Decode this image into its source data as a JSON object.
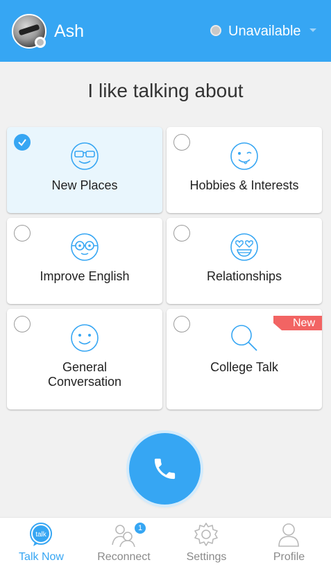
{
  "header": {
    "user_name": "Ash",
    "status_label": "Unavailable",
    "colors": {
      "header_bg": "#36a6f3",
      "status_dot": "#c8c8c8"
    }
  },
  "heading": "I like talking about",
  "topics": [
    {
      "label": "New Places",
      "icon": "sunglasses-face-icon",
      "selected": true
    },
    {
      "label": "Hobbies & Interests",
      "icon": "winking-face-icon",
      "selected": false
    },
    {
      "label": "Improve English",
      "icon": "nerd-glasses-face-icon",
      "selected": false
    },
    {
      "label": "Relationships",
      "icon": "heart-eyes-face-icon",
      "selected": false
    },
    {
      "label": "General Conversation",
      "label_line1": "General",
      "label_line2": "Conversation",
      "icon": "smiling-face-icon",
      "selected": false
    },
    {
      "label": "College Talk",
      "icon": "magnifier-icon",
      "selected": false,
      "badge": "New"
    }
  ],
  "call_button": {
    "icon": "phone-icon"
  },
  "nav": [
    {
      "label": "Talk Now",
      "icon": "talk-bubble-icon",
      "active": true,
      "icon_text": "talk"
    },
    {
      "label": "Reconnect",
      "icon": "people-icon",
      "active": false,
      "badge_count": "1"
    },
    {
      "label": "Settings",
      "icon": "gear-icon",
      "active": false
    },
    {
      "label": "Profile",
      "icon": "person-icon",
      "active": false
    }
  ],
  "colors": {
    "accent": "#36a6f3",
    "selected_card_bg": "#e9f6fd",
    "new_badge": "#f26463"
  }
}
